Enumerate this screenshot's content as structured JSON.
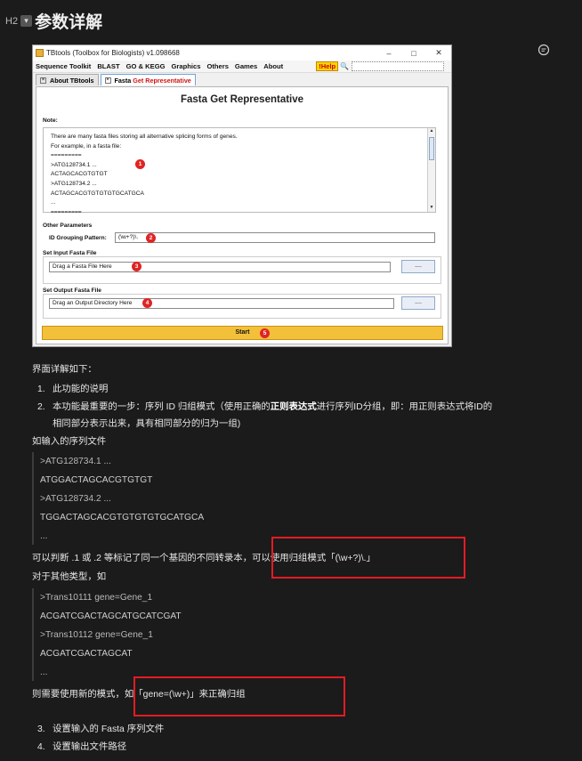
{
  "heading": {
    "tag": "H2",
    "chevron": "▾",
    "title": "参数详解"
  },
  "app": {
    "window_title": "TBtools (Toolbox for Biologists) v1.098668",
    "controls": {
      "minimize": "–",
      "maximize": "□",
      "close": "✕"
    },
    "menu": [
      "Sequence Toolkit",
      "BLAST",
      "GO & KEGG",
      "Graphics",
      "Others",
      "Games",
      "About"
    ],
    "help_label": "!Help",
    "tabs": [
      {
        "label": "About TBtools"
      },
      {
        "label_plain": "Fasta",
        "label_red": "Get Representative"
      }
    ],
    "panel_title": "Fasta Get Representative",
    "note_label": "Note:",
    "note_lines": [
      "There are many fasta files storing all alternative splicing forms of genes.",
      "For example, in a fasta file:",
      "=========",
      ">ATG128734.1 ...",
      "ACTAGCACGTGTGT",
      ">ATG128734.2 ...",
      "ACTAGCACGTGTGTGTGCATGCA",
      "...",
      "========="
    ],
    "other_params_label": "Other Parameters",
    "id_grouping_label": "ID Grouping Pattern:",
    "id_grouping_value": "(\\w+?)\\.",
    "input_label": "Set Input Fasta File",
    "input_value": "Drag a Fasta File Here",
    "output_label": "Set Output Fasta File",
    "output_value": "Drag an Output Directory Here",
    "browse_label": "....",
    "start_label": "Start",
    "markers": [
      "1",
      "2",
      "3",
      "4",
      "5"
    ]
  },
  "article": {
    "intro": "界面详解如下：",
    "item1_num": "1.",
    "item1": "此功能的说明",
    "item2_num": "2.",
    "item2_a": "本功能最重要的一步：序列 ID 归组模式（使用正确的",
    "item2_bold": "正则表达式",
    "item2_b": "进行序列ID分组，即：用正则表达式将ID的",
    "item2_line2": "相同部分表示出来，具有相同部分的归为一组)",
    "example_intro": "如输入的序列文件",
    "quote1": [
      ">ATG128734.1 ...",
      "ATGGACTAGCACGTGTGT",
      ">ATG128734.2 ...",
      "TGGACTAGCACGTGTGTGTGCATGCA",
      "..."
    ],
    "judge_line": "可以判断 .1 或 .2 等标记了同一个基因的不同转录本，可以使用归组模式「(\\w+?)\\.」",
    "other_types": "对于其他类型，如",
    "quote2": [
      ">Trans10111 gene=Gene_1",
      "ACGATCGACTAGCATGCATCGAT",
      ">Trans10112 gene=Gene_1",
      "ACGATCGACTAGCAT",
      "..."
    ],
    "new_pattern": "则需要使用新的模式，如「gene=(\\w+)」来正确归组",
    "item3_num": "3.",
    "item3": "设置输入的 Fasta 序列文件",
    "item4_num": "4.",
    "item4": "设置输出文件路径"
  },
  "colors": {
    "highlight_box": "#e41b23",
    "start_button": "#f3c03a",
    "marker": "#e02424"
  }
}
